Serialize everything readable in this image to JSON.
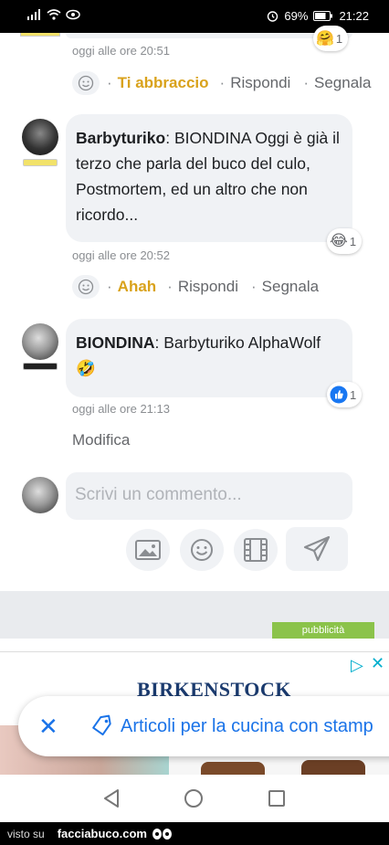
{
  "status_bar": {
    "battery": "69%",
    "time": "21:22"
  },
  "comments": [
    {
      "time": "oggi alle ore 20:51",
      "reaction_label": "Ti abbraccio",
      "reply": "Rispondi",
      "report": "Segnala",
      "reaction_count": "1",
      "reaction_icon": "hug-emoji-icon"
    },
    {
      "author": "Barbyturiko",
      "text": ": BIONDINA Oggi è già il terzo che parla del buco del culo, Postmortem, ed un altro che non ricordo...",
      "time": "oggi alle ore 20:52",
      "reaction_label": "Ahah",
      "reply": "Rispondi",
      "report": "Segnala",
      "reaction_count": "1",
      "reaction_icon": "laughing-emoji-icon"
    },
    {
      "author": "BIONDINA",
      "text": ": Barbyturiko AlphaWolf",
      "emoji": "🤣",
      "time": "oggi alle ore 21:13",
      "edit": "Modifica",
      "reaction_count": "1",
      "reaction_icon": "like-icon"
    }
  ],
  "composer": {
    "placeholder": "Scrivi un commento..."
  },
  "ad": {
    "label": "pubblicità",
    "brand": "BIRKENSTOCK",
    "toast_text": "Articoli per la cucina con stamp"
  },
  "footer": {
    "visto": "visto su",
    "site": "facciabuco.com"
  },
  "colors": {
    "reaction_label": "#d9a21b",
    "link_blue": "#1a73e8",
    "ad_green": "#8bc34a",
    "bubble_bg": "#f0f2f5"
  }
}
